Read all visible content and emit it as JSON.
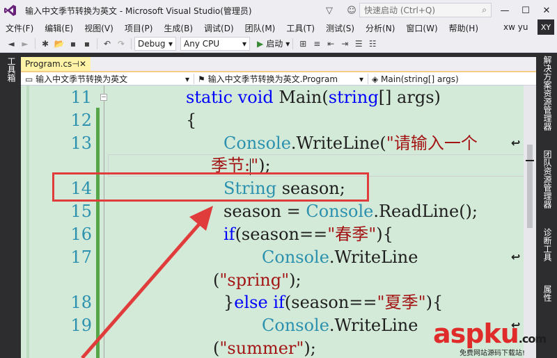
{
  "window": {
    "title": "输入中文季节转换为英文 - Microsoft Visual Studio(管理员)",
    "quick_launch": "快速启动 (Ctrl+Q)"
  },
  "menu": [
    "文件(F)",
    "编辑(E)",
    "视图(V)",
    "项目(P)",
    "生成(B)",
    "调试(D)",
    "团队(M)",
    "工具(T)",
    "测试(S)",
    "分析(N)",
    "窗口(W)",
    "帮助(H)"
  ],
  "user": {
    "name": "xw yu",
    "initials": "XY"
  },
  "toolbar": {
    "config": "Debug",
    "platform": "Any CPU",
    "start_label": "启动"
  },
  "side": {
    "left_tab": "工具箱",
    "right_tabs": [
      "解决方案资源管理器",
      "团队资源管理器",
      "诊断工具",
      "属性"
    ]
  },
  "doc_tab": {
    "label": "Program.cs"
  },
  "nav": {
    "project": "输入中文季节转换为英文",
    "class": "输入中文季节转换为英文.Program",
    "member": "Main(string[] args)"
  },
  "code": {
    "line_numbers": [
      "11",
      "12",
      "13",
      "14",
      "15",
      "16",
      "17",
      "18",
      "19"
    ],
    "l11_kw1": "static",
    "l11_kw2": "void",
    "l11_name": "Main(",
    "l11_type": "string",
    "l11_rest": "[] args)",
    "l12": "{",
    "l13_type": "Console",
    "l13_call": ".WriteLine(",
    "l13_str": "\"请输入一个",
    "l13b_str": "季节:",
    "l13b_str2": "\"",
    "l13b_rest": ");",
    "l14_type": "String",
    "l14_rest": " season;",
    "l15_a": "season = ",
    "l15_type": "Console",
    "l15_b": ".ReadLine();",
    "l16_kw": "if",
    "l16_a": "(season==",
    "l16_str": "\"春季\"",
    "l16_b": "){",
    "l17_type": "Console",
    "l17_call": ".WriteLine",
    "l17b_a": "(",
    "l17b_str": "\"spring\"",
    "l17b_b": ");",
    "l18_a": "}",
    "l18_kw1": "else",
    "l18_kw2": "if",
    "l18_b": "(season==",
    "l18_str": "\"夏季\"",
    "l18_c": "){",
    "l19_type": "Console",
    "l19_call": ".WriteLine",
    "l19b_a": "(",
    "l19b_str": "\"summer\"",
    "l19b_b": ");"
  },
  "watermark": {
    "brand": "aspku",
    "tld": ".com",
    "tagline": "免费网站源码下载站!"
  },
  "colors": {
    "editor_bg": "#d4ead8",
    "keyword": "#0000ff",
    "type": "#2b91af",
    "string": "#a31515",
    "annotation": "#e03c3c"
  }
}
